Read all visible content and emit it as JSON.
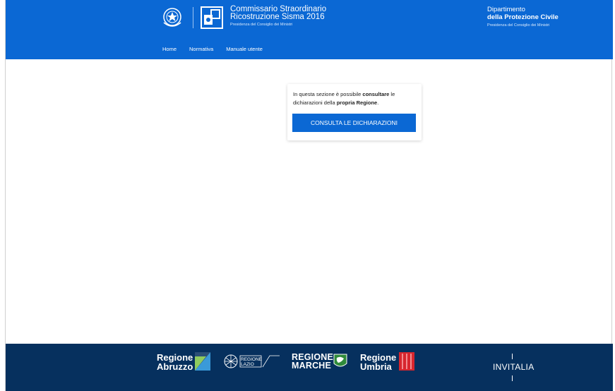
{
  "header": {
    "title_line1": "Commissario Straordinario",
    "title_line2": "Ricostruzione Sisma 2016",
    "title_sub": "Presidenza del Consiglio dei Ministri",
    "dpc_line1": "Dipartimento",
    "dpc_line2": "della Protezione Civile",
    "dpc_sub": "Presidenza del Consiglio dei Ministri"
  },
  "nav": [
    {
      "label": "Home"
    },
    {
      "label": "Normativa"
    },
    {
      "label": "Manuale utente"
    }
  ],
  "card": {
    "text_part1": "In questa sezione è possibile ",
    "text_bold1": "consultare",
    "text_part2": " le dichiarazioni della ",
    "text_bold2": "propria Regione",
    "text_part3": ".",
    "button_label": "CONSULTA LE DICHIARAZIONI"
  },
  "footer": {
    "abruzzo_line1": "Regione",
    "abruzzo_line2": "Abruzzo",
    "lazio_line1": "REGIONE",
    "lazio_line2": "LAZIO",
    "marche_line1": "REGIONE",
    "marche_line2": "MARCHE",
    "umbria_line1": "Regione",
    "umbria_line2": "Umbria",
    "invitalia": "INVITALIA"
  },
  "colors": {
    "header_blue": "#0b68d4",
    "footer_navy": "#06305e",
    "button_blue": "#0b68d4"
  }
}
